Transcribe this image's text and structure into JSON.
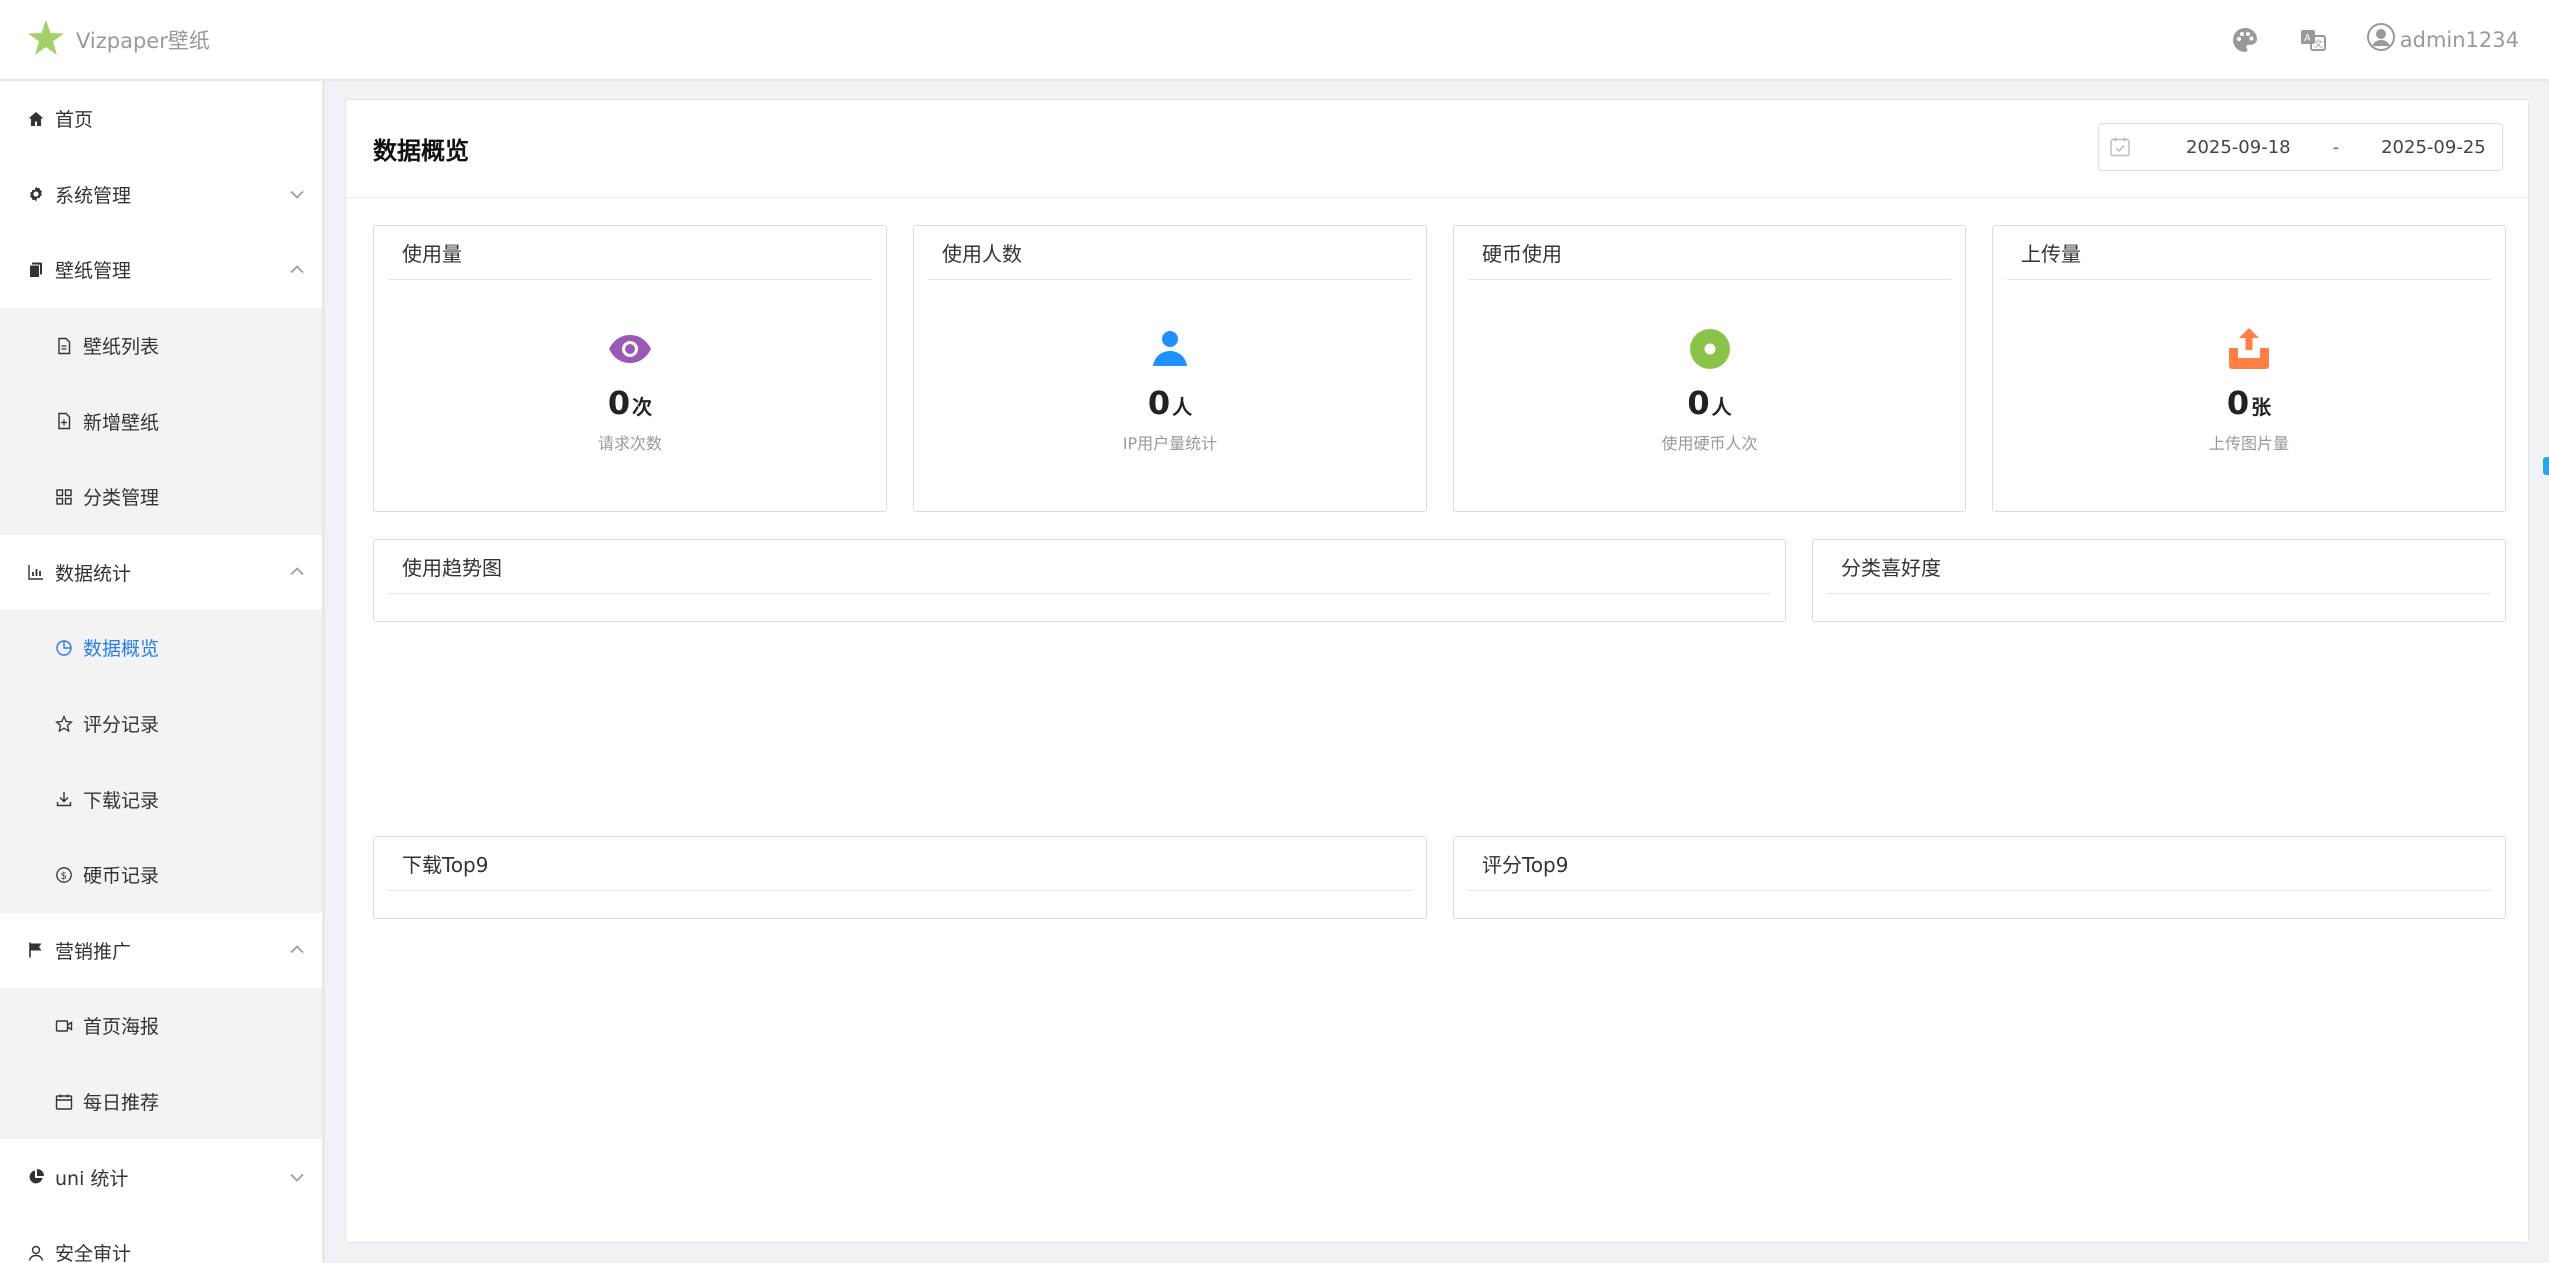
{
  "header": {
    "brand": "Vizpaper壁纸",
    "username": "admin1234",
    "icons": [
      "star-logo-icon",
      "palette-icon",
      "translate-icon",
      "user-avatar-icon"
    ]
  },
  "sidebar": {
    "items": [
      {
        "label": "首页",
        "icon": "home-icon",
        "level": 0,
        "arrow": "none"
      },
      {
        "label": "系统管理",
        "icon": "gear-icon",
        "level": 0,
        "arrow": "down"
      },
      {
        "label": "壁纸管理",
        "icon": "copy-icon",
        "level": 0,
        "arrow": "up"
      },
      {
        "label": "壁纸列表",
        "icon": "document-icon",
        "level": 1
      },
      {
        "label": "新增壁纸",
        "icon": "document-add-icon",
        "level": 1
      },
      {
        "label": "分类管理",
        "icon": "grid-icon",
        "level": 1
      },
      {
        "label": "数据统计",
        "icon": "bar-chart-icon",
        "level": 0,
        "arrow": "up"
      },
      {
        "label": "数据概览",
        "icon": "pie-outline-icon",
        "level": 1,
        "active": true
      },
      {
        "label": "评分记录",
        "icon": "star-outline-icon",
        "level": 1
      },
      {
        "label": "下载记录",
        "icon": "download-icon",
        "level": 1
      },
      {
        "label": "硬币记录",
        "icon": "coin-icon",
        "level": 1
      },
      {
        "label": "营销推广",
        "icon": "flag-icon",
        "level": 0,
        "arrow": "up"
      },
      {
        "label": "首页海报",
        "icon": "video-icon",
        "level": 1
      },
      {
        "label": "每日推荐",
        "icon": "calendar-icon",
        "level": 1
      },
      {
        "label": "uni 统计",
        "icon": "pie-chart-icon",
        "level": 0,
        "arrow": "down"
      },
      {
        "label": "安全审计",
        "icon": "user-outline-icon",
        "level": 0,
        "arrow": "none"
      }
    ]
  },
  "main": {
    "title": "数据概览",
    "date_range": {
      "start": "2025-09-18",
      "separator": "-",
      "end": "2025-09-25"
    },
    "stats": [
      {
        "title": "使用量",
        "value": "0",
        "unit": "次",
        "desc": "请求次数",
        "icon": "eye-icon",
        "color": "#9b59b6"
      },
      {
        "title": "使用人数",
        "value": "0",
        "unit": "人",
        "desc": "IP用户量统计",
        "icon": "person-icon",
        "color": "#1e90ff"
      },
      {
        "title": "硬币使用",
        "value": "0",
        "unit": "人",
        "desc": "使用硬币人次",
        "icon": "coin-dot-icon",
        "color": "#8bc34a"
      },
      {
        "title": "上传量",
        "value": "0",
        "unit": "张",
        "desc": "上传图片量",
        "icon": "upload-icon",
        "color": "#ff7f45"
      }
    ],
    "charts": {
      "trend_title": "使用趋势图",
      "category_title": "分类喜好度",
      "download_title": "下载Top9",
      "rating_title": "评分Top9"
    }
  },
  "colors": {
    "accent": "#2b7de9",
    "logo": "#a3d06b"
  }
}
